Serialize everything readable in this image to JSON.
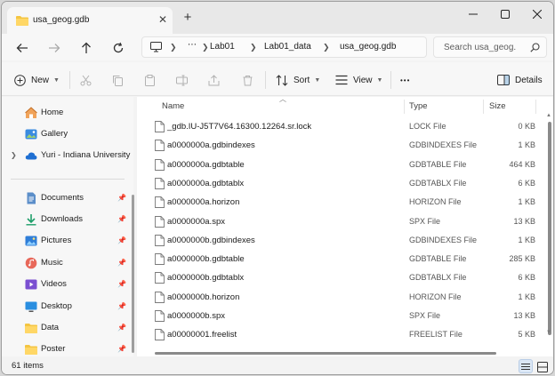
{
  "tab": {
    "title": "usa_geog.gdb"
  },
  "window_controls": {
    "minimize": "minimize",
    "maximize": "maximize",
    "close": "close"
  },
  "address": {
    "more": "⋯",
    "crumbs": [
      "Lab01",
      "Lab01_data",
      "usa_geog.gdb"
    ]
  },
  "search": {
    "placeholder": "Search usa_geog."
  },
  "toolbar": {
    "new_label": "New",
    "sort_label": "Sort",
    "view_label": "View",
    "more": "•••",
    "details_label": "Details"
  },
  "sidebar": {
    "items": [
      {
        "label": "Home",
        "icon": "home-icon"
      },
      {
        "label": "Gallery",
        "icon": "gallery-icon"
      },
      {
        "label": "Yuri - Indiana University",
        "icon": "cloud-icon"
      },
      {
        "label": "Documents",
        "icon": "documents-icon"
      },
      {
        "label": "Downloads",
        "icon": "downloads-icon"
      },
      {
        "label": "Pictures",
        "icon": "pictures-icon"
      },
      {
        "label": "Music",
        "icon": "music-icon"
      },
      {
        "label": "Videos",
        "icon": "videos-icon"
      },
      {
        "label": "Desktop",
        "icon": "desktop-icon"
      },
      {
        "label": "Data",
        "icon": "folder-icon"
      },
      {
        "label": "Poster",
        "icon": "folder-icon"
      }
    ]
  },
  "columns": {
    "name": "Name",
    "type": "Type",
    "size": "Size"
  },
  "files": [
    {
      "name": "_gdb.IU-J5T7V64.16300.12264.sr.lock",
      "type": "LOCK File",
      "size": "0 KB"
    },
    {
      "name": "a0000000a.gdbindexes",
      "type": "GDBINDEXES File",
      "size": "1 KB"
    },
    {
      "name": "a0000000a.gdbtable",
      "type": "GDBTABLE File",
      "size": "464 KB"
    },
    {
      "name": "a0000000a.gdbtablx",
      "type": "GDBTABLX File",
      "size": "6 KB"
    },
    {
      "name": "a0000000a.horizon",
      "type": "HORIZON File",
      "size": "1 KB"
    },
    {
      "name": "a0000000a.spx",
      "type": "SPX File",
      "size": "13 KB"
    },
    {
      "name": "a0000000b.gdbindexes",
      "type": "GDBINDEXES File",
      "size": "1 KB"
    },
    {
      "name": "a0000000b.gdbtable",
      "type": "GDBTABLE File",
      "size": "285 KB"
    },
    {
      "name": "a0000000b.gdbtablx",
      "type": "GDBTABLX File",
      "size": "6 KB"
    },
    {
      "name": "a0000000b.horizon",
      "type": "HORIZON File",
      "size": "1 KB"
    },
    {
      "name": "a0000000b.spx",
      "type": "SPX File",
      "size": "13 KB"
    },
    {
      "name": "a00000001.freelist",
      "type": "FREELIST File",
      "size": "5 KB"
    }
  ],
  "status": {
    "count": "61 items"
  },
  "colors": {
    "accent": "#0067c0",
    "folder": "#f4c542"
  }
}
